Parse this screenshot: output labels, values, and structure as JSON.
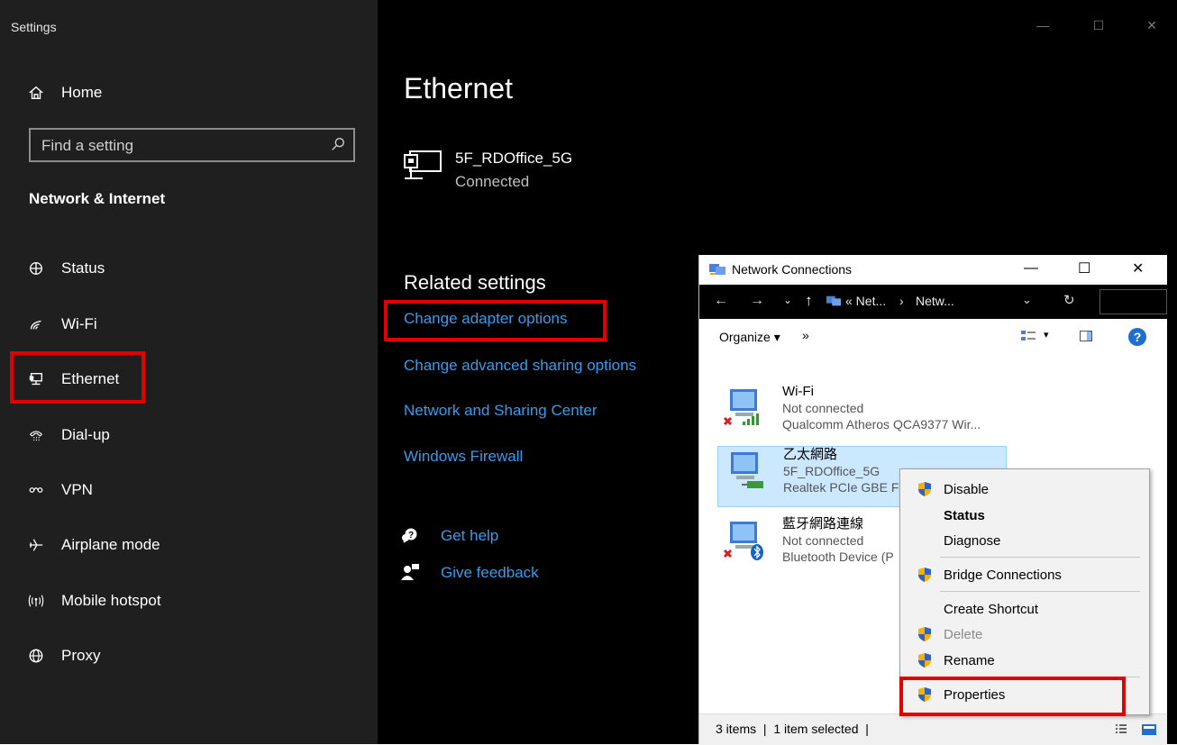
{
  "settings": {
    "window_title": "Settings",
    "home_label": "Home",
    "search_placeholder": "Find a setting",
    "section_title": "Network & Internet",
    "nav": [
      {
        "label": "Status",
        "icon": "globe-status-icon"
      },
      {
        "label": "Wi-Fi",
        "icon": "wifi-icon"
      },
      {
        "label": "Ethernet",
        "icon": "ethernet-icon"
      },
      {
        "label": "Dial-up",
        "icon": "dialup-icon"
      },
      {
        "label": "VPN",
        "icon": "vpn-icon"
      },
      {
        "label": "Airplane mode",
        "icon": "airplane-icon"
      },
      {
        "label": "Mobile hotspot",
        "icon": "hotspot-icon"
      },
      {
        "label": "Proxy",
        "icon": "proxy-globe-icon"
      }
    ]
  },
  "main": {
    "page_title": "Ethernet",
    "network_name": "5F_RDOffice_5G",
    "network_status": "Connected",
    "related_title": "Related settings",
    "related_links": [
      "Change adapter options",
      "Change advanced sharing options",
      "Network and Sharing Center",
      "Windows Firewall"
    ],
    "help_label": "Get help",
    "feedback_label": "Give feedback"
  },
  "network_connections": {
    "title": "Network Connections",
    "breadcrumb_1": "« Net...",
    "breadcrumb_sep": "›",
    "breadcrumb_2": "Netw...",
    "organize_label": "Organize ▾",
    "more_label": "»",
    "adapters": [
      {
        "name": "Wi-Fi",
        "status": "Not connected",
        "device": "Qualcomm Atheros QCA9377 Wir..."
      },
      {
        "name": "乙太網路",
        "status": "5F_RDOffice_5G",
        "device": "Realtek PCIe GBE Fa"
      },
      {
        "name": "藍牙網路連線",
        "status": "Not connected",
        "device": "Bluetooth Device (P"
      }
    ],
    "status_bar": "3 items  |  1 item selected  |"
  },
  "context_menu": {
    "items": [
      "Disable",
      "Status",
      "Diagnose",
      "Bridge Connections",
      "Create Shortcut",
      "Delete",
      "Rename",
      "Properties"
    ]
  },
  "colors": {
    "sidebar_bg": "#1f1f1f",
    "main_bg": "#000000",
    "link": "#3a9bea",
    "highlight": "#e00000",
    "selection": "#cce8ff"
  }
}
